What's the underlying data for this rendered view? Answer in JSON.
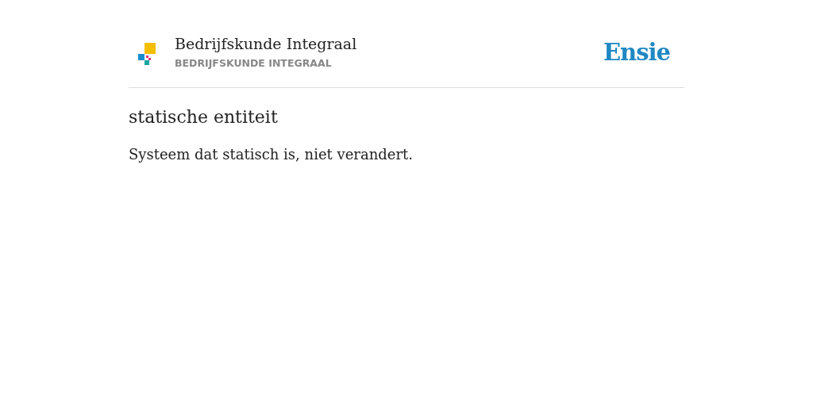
{
  "header": {
    "title": "Bedrijfskunde Integraal",
    "subtitle": "BEDRIJFSKUNDE INTEGRAAL",
    "brand": "Ensie"
  },
  "entry": {
    "term": "statische entiteit",
    "definition": "Systeem dat statisch is, niet verandert."
  }
}
